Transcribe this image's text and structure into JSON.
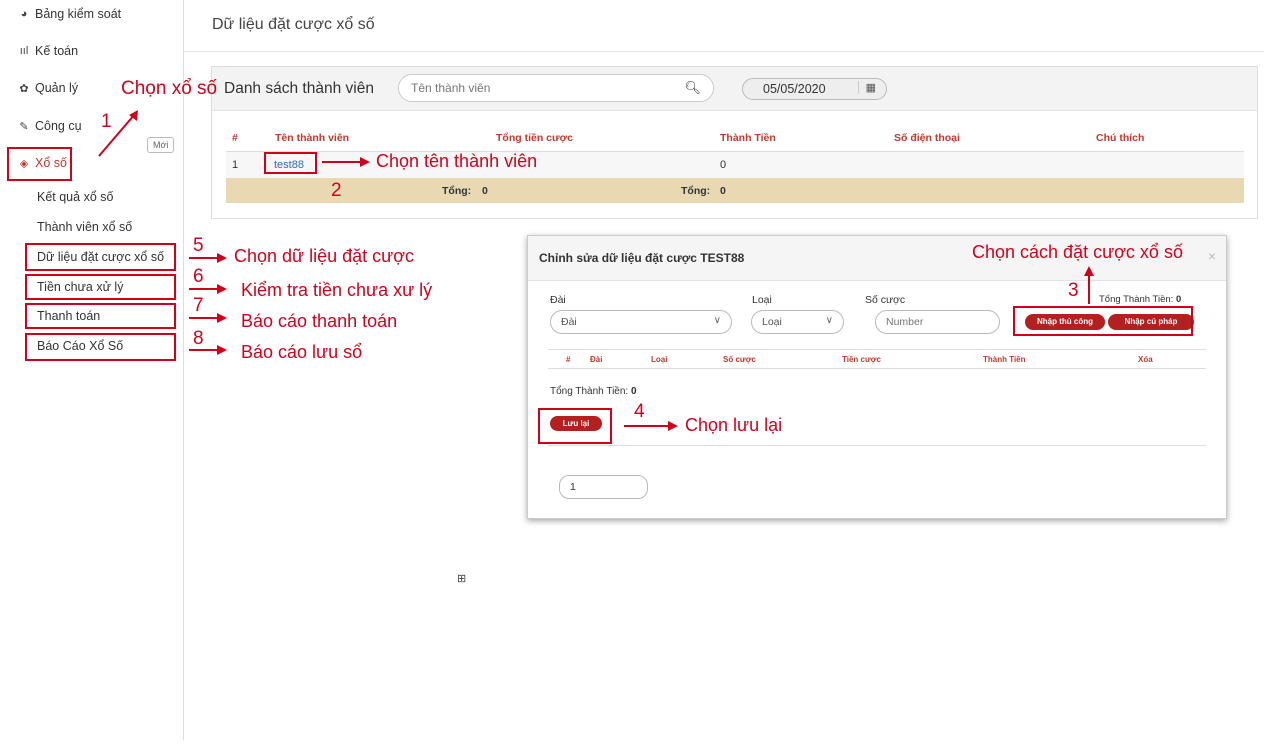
{
  "sidebar": {
    "items": [
      {
        "label": "Bảng kiểm soát",
        "icon": "pie-chart-icon"
      },
      {
        "label": "Kế toán",
        "icon": "bar-chart-icon"
      },
      {
        "label": "Quản lý",
        "icon": "gear-icon"
      },
      {
        "label": "Công cụ",
        "icon": "wrench-icon"
      },
      {
        "label": "Xổ số",
        "icon": "ticket-icon"
      }
    ],
    "badge_new": "Mới",
    "sub_items": [
      {
        "label": "Kết quả xổ số"
      },
      {
        "label": "Thành viên xổ số"
      },
      {
        "label": "Dữ liệu đặt cược xổ số"
      },
      {
        "label": "Tiền chưa xử lý"
      },
      {
        "label": "Thanh toán"
      },
      {
        "label": "Báo Cáo Xổ Số"
      }
    ]
  },
  "page": {
    "title": "Dữ liệu đặt cược xổ số"
  },
  "panel": {
    "title": "Danh sách thành viên",
    "search_placeholder": "Tên thành viên",
    "date": "05/05/2020",
    "columns": [
      "#",
      "Tên thành viên",
      "Tổng tiền cược",
      "Thành Tiền",
      "Số điện thoại",
      "Chú thích"
    ],
    "rows": [
      {
        "index": "1",
        "member": "test88",
        "amount": "0"
      }
    ],
    "total_label_1": "Tổng:",
    "total_value_1": "0",
    "total_label_2": "Tổng:",
    "total_value_2": "0"
  },
  "modal": {
    "title": "Chỉnh sửa dữ liệu đặt cược TEST88",
    "close": "×",
    "dai_label": "Đài",
    "dai_value": "Đài",
    "loai_label": "Loại",
    "loai_value": "Loại",
    "socuoc_label": "Số cược",
    "socuoc_placeholder": "Number",
    "total_top_label": "Tổng Thành Tiền:",
    "total_top_value": "0",
    "btn_manual": "Nhập thủ công",
    "btn_syntax": "Nhập cú pháp",
    "columns": [
      "#",
      "Đài",
      "Loại",
      "Số cược",
      "Tiền cược",
      "Thành Tiền",
      "Xóa"
    ],
    "total_bottom_label": "Tổng Thành Tiền:",
    "total_bottom_value": "0",
    "save_label": "Lưu lại",
    "page_value": "1"
  },
  "annotations": {
    "chon_xo_so": "Chọn xổ số",
    "chon_thanh_vien": "Chọn tên thành viên",
    "chon_cach_dat": "Chọn cách đặt cược xổ số",
    "chon_luu_lai": "Chọn lưu lại",
    "chon_du_lieu": "Chọn dữ liệu đặt cược",
    "kiem_tra_tien": "Kiểm tra tiền chưa xư lý",
    "bao_cao_tt": "Báo cáo thanh toán",
    "bao_cao_luu": "Báo cáo lưu sổ",
    "n1": "1",
    "n2": "2",
    "n3": "3",
    "n4": "4",
    "n5": "5",
    "n6": "6",
    "n7": "7",
    "n8": "8"
  },
  "colors": {
    "annotation_red": "#d0021b",
    "header_red": "#c0392b",
    "button_red": "#b3201f",
    "total_row": "#e8d9b2"
  }
}
